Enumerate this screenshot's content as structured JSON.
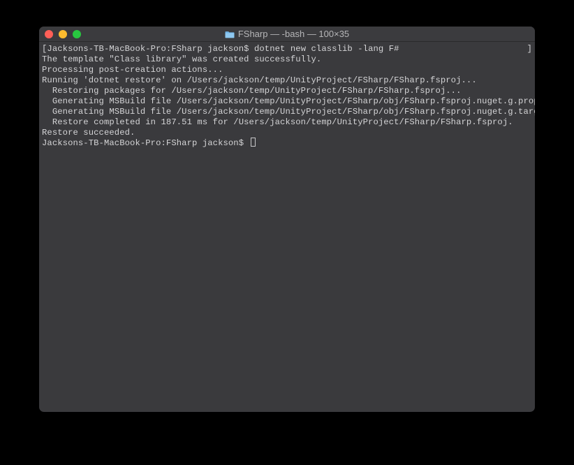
{
  "titlebar": {
    "title": "FSharp — -bash — 100×35",
    "folder_icon": "folder-icon"
  },
  "terminal": {
    "prompt1_left": "[Jacksons-TB-MacBook-Pro:FSharp jackson$ ",
    "prompt1_cmd": "dotnet new classlib -lang F#",
    "prompt1_right": "]",
    "lines": [
      "The template \"Class library\" was created successfully.",
      "",
      "Processing post-creation actions...",
      "Running 'dotnet restore' on /Users/jackson/temp/UnityProject/FSharp/FSharp.fsproj...",
      "  Restoring packages for /Users/jackson/temp/UnityProject/FSharp/FSharp.fsproj...",
      "  Generating MSBuild file /Users/jackson/temp/UnityProject/FSharp/obj/FSharp.fsproj.nuget.g.props.",
      "  Generating MSBuild file /Users/jackson/temp/UnityProject/FSharp/obj/FSharp.fsproj.nuget.g.targets.",
      "  Restore completed in 187.51 ms for /Users/jackson/temp/UnityProject/FSharp/FSharp.fsproj.",
      "",
      "Restore succeeded.",
      ""
    ],
    "prompt2": "Jacksons-TB-MacBook-Pro:FSharp jackson$ "
  }
}
